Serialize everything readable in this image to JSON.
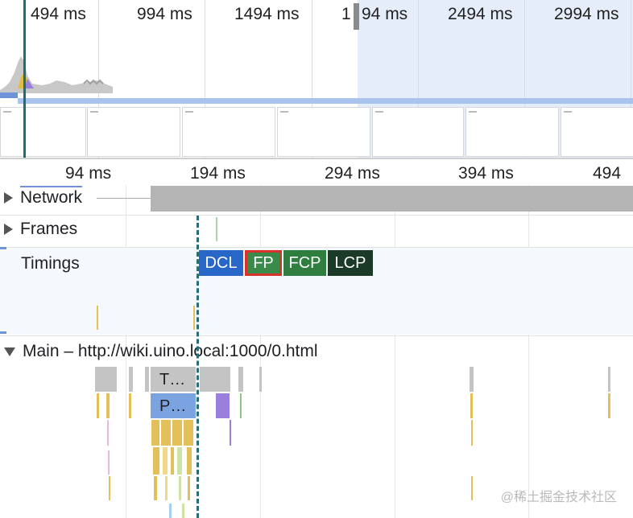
{
  "overview": {
    "time_labels": [
      "494 ms",
      "994 ms",
      "1494 ms",
      "1",
      "94 ms",
      "2494 ms",
      "2994 ms"
    ]
  },
  "ruler": {
    "labels": [
      "94 ms",
      "194 ms",
      "294 ms",
      "394 ms",
      "494"
    ]
  },
  "tracks": {
    "network": "Network",
    "frames": "Frames",
    "timings": "Timings",
    "main": "Main – http://wiki.uino.local:1000/0.html"
  },
  "timing_markers": [
    {
      "label": "DCL",
      "color": "#2866c8"
    },
    {
      "label": "FP",
      "color": "#3a8a4a"
    },
    {
      "label": "FCP",
      "color": "#2f7d3f"
    },
    {
      "label": "LCP",
      "color": "#1b3a27"
    }
  ],
  "main_tasks": {
    "task_label": "T…",
    "parse_label": "P…"
  },
  "colors": {
    "task_gray": "#c4c4c4",
    "parse_blue": "#7ba3e0",
    "script_yellow": "#e3c05a",
    "purple": "#9b7fdc",
    "selected_outline": "#d9322a"
  },
  "watermark": "@稀土掘金技术社区"
}
